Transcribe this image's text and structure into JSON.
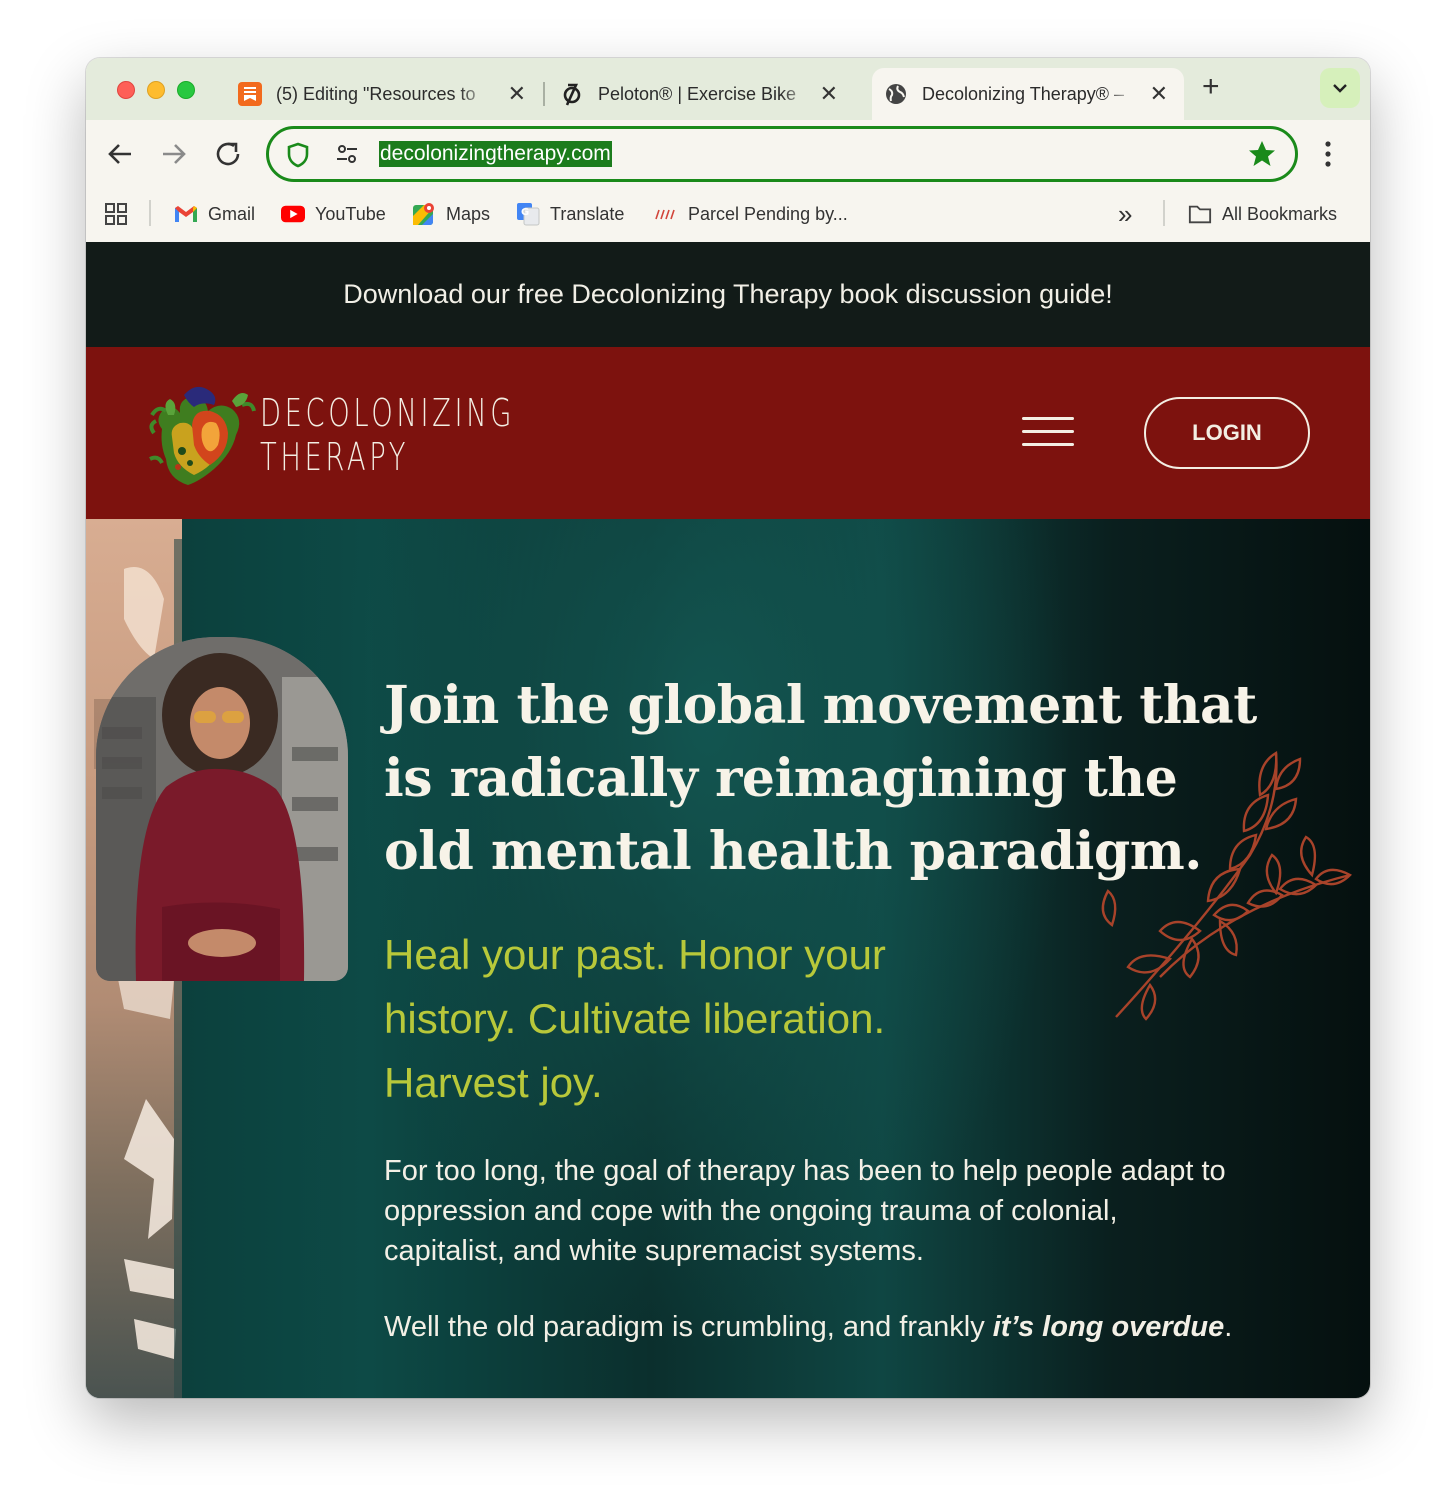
{
  "browser": {
    "tabs": [
      {
        "title": "(5) Editing \"Resources to",
        "favicon": "substack-icon",
        "active": false
      },
      {
        "title": "Peloton® | Exercise Bike",
        "favicon": "peloton-icon",
        "active": false
      },
      {
        "title": "Decolonizing Therapy® –",
        "favicon": "globe-icon",
        "active": true
      }
    ],
    "new_tab_label": "+",
    "url": "decolonizingtherapy.com",
    "accent_color": "#1c7c1c"
  },
  "bookmarks": {
    "items": [
      {
        "label": "Gmail",
        "icon": "gmail-icon"
      },
      {
        "label": "YouTube",
        "icon": "youtube-icon"
      },
      {
        "label": "Maps",
        "icon": "maps-icon"
      },
      {
        "label": "Translate",
        "icon": "translate-icon"
      },
      {
        "label": "Parcel Pending by...",
        "icon": "parcel-icon"
      }
    ],
    "overflow_label": "»",
    "all_bookmarks_label": "All Bookmarks"
  },
  "site": {
    "announcement": "Download our free Decolonizing Therapy book discussion guide!",
    "logo": {
      "line1": "DECOLONIZING",
      "line2": "THERAPY"
    },
    "login_label": "LOGIN",
    "colors": {
      "header": "#7d120e",
      "announcement_bg": "#121b18",
      "tagline": "#b8c83a"
    },
    "hero": {
      "headline": "Join the global movement that is radically reimagining the old mental health paradigm.",
      "tagline": "Heal your past. Honor your history. Cultivate liberation. Harvest joy.",
      "paragraph1": "For too long, the goal of therapy has been to help people adapt to oppression and cope with the ongoing trauma of colonial, capitalist, and white supremacist systems.",
      "paragraph2_start": "Well the old paradigm is crumbling, and frankly ",
      "paragraph2_emphasis": "it’s long overdue",
      "paragraph2_end": "."
    }
  }
}
